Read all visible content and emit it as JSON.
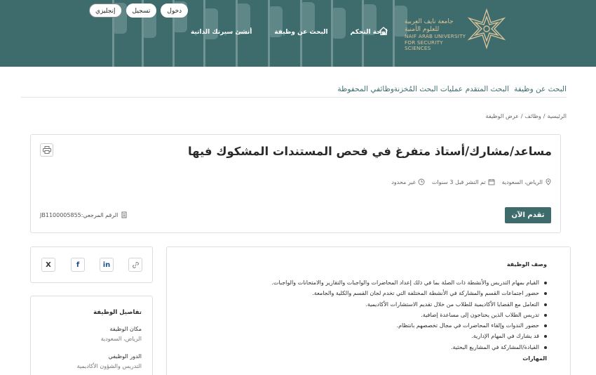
{
  "header": {
    "auth": {
      "login": "دخول",
      "register": "تسجيل",
      "language": "إنجليزي"
    },
    "nav": {
      "create_cv": "أنشئ سيرتك الذاتية",
      "job_search": "البحث عن وظيفة",
      "dashboard": "لوحة التحكم"
    },
    "logo": {
      "arabic_name": "جامعة نايف العربية للعلوم الأمنية",
      "english_name_1": "NAIF ARAB UNIVERSITY",
      "english_name_2": "FOR SECURITY SCIENCES"
    }
  },
  "subnav": {
    "search": "البحث عن وظيفة",
    "advanced": "البحث المتقدم",
    "saved_searches": "عمليات البحث المُخزنة",
    "saved_jobs": "وظائفي المحفوظة"
  },
  "breadcrumb": {
    "home": "الرئيسية",
    "jobs": "وظائف",
    "current": "عرض الوظيفة"
  },
  "job": {
    "title": "مساعد/مشارك/أستاذ متفرغ في فحص المستندات المشكوك فيها",
    "location": "الرياض، السعودية",
    "posted": "تم النشر قبل 3 سنوات",
    "duration": "غير محدود",
    "apply_label": "تقدم الآن",
    "reference": "الرقم المرجعي:JB1100005855"
  },
  "share": {
    "x": "X",
    "facebook": "f",
    "linkedin": "in"
  },
  "details": {
    "title": "تفاصيل الوظيفة",
    "location_label": "مكان الوظيفة",
    "location_value": "الرياض، السعودية",
    "role_label": "الدور الوظيفي",
    "role_value": "التدريس والشؤون الأكاديمية"
  },
  "description": {
    "title": "وصف الوظيفة",
    "items": [
      "القيام بمهام التدريس والأنشطة ذات الصلة بما في ذلك إعداد المحاضرات والواجبات والتقارير والامتحانات والواجبات.",
      "حضور اجتماعات القسم والمشاركة في الأنشطة المختلفة التي تخدم لجان القسم والكلية والجامعة.",
      "التعامل مع القضايا الأكاديمية للطلاب من خلال تقديم الاستشارات الأكاديمية.",
      "تدريس الطلاب الذين يحتاجون إلى مساعدة إضافية.",
      "حضور الندوات وإلقاء المحاضرات في مجال تخصصهم بانتظام.",
      "قد يشارك في المهام الإدارية.",
      "القيادة/المشاركة في المشاريع البحثية."
    ],
    "skills_title": "المهارات"
  },
  "colors": {
    "brand": "#3e6c6d",
    "gold": "#d8c29a"
  }
}
